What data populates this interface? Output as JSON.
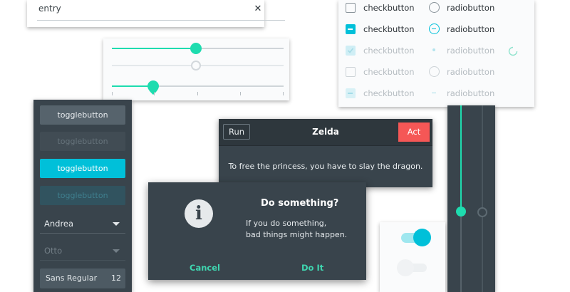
{
  "colors": {
    "accent": "#1edcaf",
    "accent_cyan": "#00c0d9",
    "destructive": "#f55756",
    "dark_panel": "#39444c"
  },
  "entry": {
    "text": "entry",
    "clear_icon": "close-icon",
    "clear_glyph": "✕"
  },
  "sliders": {
    "slider1_value": 0.5,
    "slider2_value": 0.5,
    "slider3_value": 0.25
  },
  "checks": {
    "rows": [
      {
        "check_label": "checkbutton",
        "check_state": "unchecked",
        "radio_label": "radiobutton",
        "radio_state": "unchecked",
        "sensitive": true
      },
      {
        "check_label": "checkbutton",
        "check_state": "mixed",
        "radio_label": "radiobutton",
        "radio_state": "mixed",
        "sensitive": true
      },
      {
        "check_label": "checkbutton",
        "check_state": "checked",
        "radio_label": "radiobutton",
        "radio_state": "checked",
        "sensitive": false
      },
      {
        "check_label": "checkbutton",
        "check_state": "unchecked",
        "radio_label": "radiobutton",
        "radio_state": "unchecked",
        "sensitive": false
      },
      {
        "check_label": "checkbutton",
        "check_state": "mixed",
        "radio_label": "radiobutton",
        "radio_state": "mixed",
        "sensitive": false
      }
    ],
    "spinner_icon": "spinner-icon"
  },
  "sidebar": {
    "toggles": [
      {
        "label": "togglebutton",
        "state": "normal"
      },
      {
        "label": "togglebutton",
        "state": "insensitive"
      },
      {
        "label": "togglebutton",
        "state": "active"
      },
      {
        "label": "togglebutton",
        "state": "active-insensitive"
      }
    ],
    "combo1": "Andrea",
    "combo2": "Otto",
    "font_name": "Sans Regular",
    "font_size": "12"
  },
  "zelda": {
    "title": "Zelda",
    "run": "Run",
    "act": "Act",
    "message": "To free the princess, you have to slay the dragon."
  },
  "dialog": {
    "title": "Do something?",
    "message_line1": "If you do something,",
    "message_line2": "bad things might happen.",
    "cancel": "Cancel",
    "confirm": "Do It",
    "icon": "info-icon",
    "icon_glyph": "i"
  },
  "switches": [
    {
      "state": "on"
    },
    {
      "state": "off-insensitive"
    }
  ],
  "vertical_scale": {
    "value": 0.55
  }
}
